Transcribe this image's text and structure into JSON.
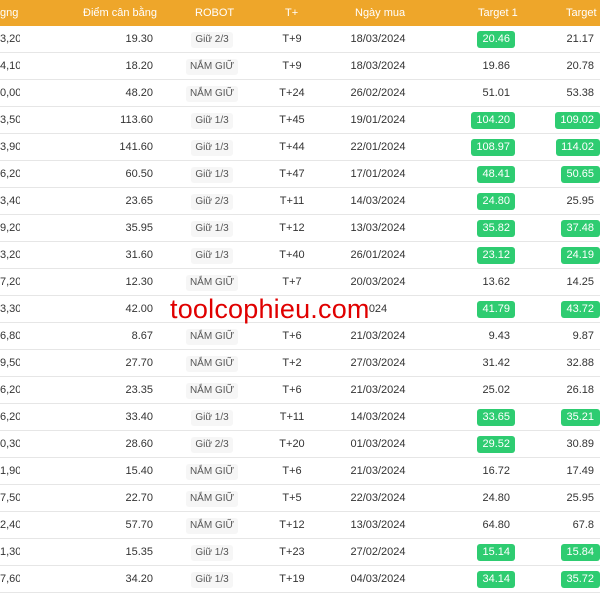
{
  "header": {
    "price": "gng",
    "balance": "Điểm cân bằng",
    "robot": "ROBOT",
    "tplus": "T+",
    "date": "Ngày mua",
    "target1": "Target 1",
    "target2": "Target 2"
  },
  "colors": {
    "header_bg": "#eea62a",
    "target_hit_bg": "#2ecc71"
  },
  "watermark": "toolcophieu.com",
  "rows": [
    {
      "price": "3,20",
      "balance": "19.30",
      "robot": "Giữ 2/3",
      "tplus": "T+9",
      "date": "18/03/2024",
      "t1": "20.46",
      "t1_hit": true,
      "t2": "21.17",
      "t2_hit": false
    },
    {
      "price": "4,10",
      "balance": "18.20",
      "robot": "NẮM GIỮ",
      "tplus": "T+9",
      "date": "18/03/2024",
      "t1": "19.86",
      "t1_hit": false,
      "t2": "20.78",
      "t2_hit": false
    },
    {
      "price": "0,00",
      "balance": "48.20",
      "robot": "NẮM GIỮ",
      "tplus": "T+24",
      "date": "26/02/2024",
      "t1": "51.01",
      "t1_hit": false,
      "t2": "53.38",
      "t2_hit": false
    },
    {
      "price": "3,50",
      "balance": "113.60",
      "robot": "Giữ 1/3",
      "tplus": "T+45",
      "date": "19/01/2024",
      "t1": "104.20",
      "t1_hit": true,
      "t2": "109.02",
      "t2_hit": true
    },
    {
      "price": "3,90",
      "balance": "141.60",
      "robot": "Giữ 1/3",
      "tplus": "T+44",
      "date": "22/01/2024",
      "t1": "108.97",
      "t1_hit": true,
      "t2": "114.02",
      "t2_hit": true
    },
    {
      "price": "6,20",
      "balance": "60.50",
      "robot": "Giữ 1/3",
      "tplus": "T+47",
      "date": "17/01/2024",
      "t1": "48.41",
      "t1_hit": true,
      "t2": "50.65",
      "t2_hit": true
    },
    {
      "price": "3,40",
      "balance": "23.65",
      "robot": "Giữ 2/3",
      "tplus": "T+11",
      "date": "14/03/2024",
      "t1": "24.80",
      "t1_hit": true,
      "t2": "25.95",
      "t2_hit": false
    },
    {
      "price": "9,20",
      "balance": "35.95",
      "robot": "Giữ 1/3",
      "tplus": "T+12",
      "date": "13/03/2024",
      "t1": "35.82",
      "t1_hit": true,
      "t2": "37.48",
      "t2_hit": true
    },
    {
      "price": "3,20",
      "balance": "31.60",
      "robot": "Giữ 1/3",
      "tplus": "T+40",
      "date": "26/01/2024",
      "t1": "23.12",
      "t1_hit": true,
      "t2": "24.19",
      "t2_hit": true
    },
    {
      "price": "7,20",
      "balance": "12.30",
      "robot": "NẮM GIỮ",
      "tplus": "T+7",
      "date": "20/03/2024",
      "t1": "13.62",
      "t1_hit": false,
      "t2": "14.25",
      "t2_hit": false
    },
    {
      "price": "3,30",
      "balance": "42.00",
      "robot": "",
      "tplus": "",
      "date": "024",
      "t1": "41.79",
      "t1_hit": true,
      "t2": "43.72",
      "t2_hit": true
    },
    {
      "price": "6,80",
      "balance": "8.67",
      "robot": "NẮM GIỮ",
      "tplus": "T+6",
      "date": "21/03/2024",
      "t1": "9.43",
      "t1_hit": false,
      "t2": "9.87",
      "t2_hit": false
    },
    {
      "price": "9,50",
      "balance": "27.70",
      "robot": "NẮM GIỮ",
      "tplus": "T+2",
      "date": "27/03/2024",
      "t1": "31.42",
      "t1_hit": false,
      "t2": "32.88",
      "t2_hit": false
    },
    {
      "price": "6,20",
      "balance": "23.35",
      "robot": "NẮM GIỮ",
      "tplus": "T+6",
      "date": "21/03/2024",
      "t1": "25.02",
      "t1_hit": false,
      "t2": "26.18",
      "t2_hit": false
    },
    {
      "price": "6,20",
      "balance": "33.40",
      "robot": "Giữ 1/3",
      "tplus": "T+11",
      "date": "14/03/2024",
      "t1": "33.65",
      "t1_hit": true,
      "t2": "35.21",
      "t2_hit": true
    },
    {
      "price": "0,30",
      "balance": "28.60",
      "robot": "Giữ 2/3",
      "tplus": "T+20",
      "date": "01/03/2024",
      "t1": "29.52",
      "t1_hit": true,
      "t2": "30.89",
      "t2_hit": false
    },
    {
      "price": "1,90",
      "balance": "15.40",
      "robot": "NẮM GIỮ",
      "tplus": "T+6",
      "date": "21/03/2024",
      "t1": "16.72",
      "t1_hit": false,
      "t2": "17.49",
      "t2_hit": false
    },
    {
      "price": "7,50",
      "balance": "22.70",
      "robot": "NẮM GIỮ",
      "tplus": "T+5",
      "date": "22/03/2024",
      "t1": "24.80",
      "t1_hit": false,
      "t2": "25.95",
      "t2_hit": false
    },
    {
      "price": "2,40",
      "balance": "57.70",
      "robot": "NẮM GIỮ",
      "tplus": "T+12",
      "date": "13/03/2024",
      "t1": "64.80",
      "t1_hit": false,
      "t2": "67.8",
      "t2_hit": false
    },
    {
      "price": "1,30",
      "balance": "15.35",
      "robot": "Giữ 1/3",
      "tplus": "T+23",
      "date": "27/02/2024",
      "t1": "15.14",
      "t1_hit": true,
      "t2": "15.84",
      "t2_hit": true
    },
    {
      "price": "7,60",
      "balance": "34.20",
      "robot": "Giữ 1/3",
      "tplus": "T+19",
      "date": "04/03/2024",
      "t1": "34.14",
      "t1_hit": true,
      "t2": "35.72",
      "t2_hit": true
    }
  ]
}
